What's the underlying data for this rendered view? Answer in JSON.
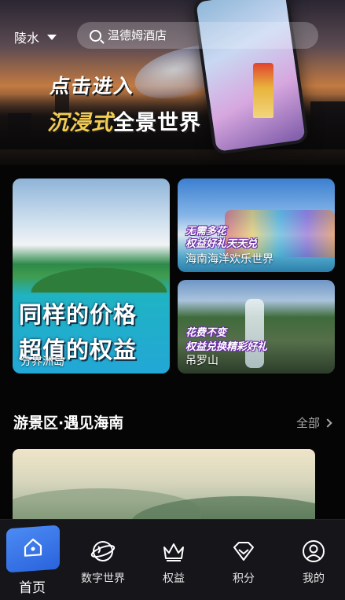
{
  "header": {
    "location": "陵水",
    "search_placeholder": "温德姆酒店"
  },
  "hero": {
    "title_line1": "点击进入",
    "title_line2_highlight": "沉浸式",
    "title_line2_rest": "全景世界"
  },
  "cards": {
    "big": {
      "slogan_line1": "同样的价格",
      "slogan_line2": "超值的权益",
      "name": "分界洲岛"
    },
    "small1": {
      "slogan_line1": "无需多花",
      "slogan_line2": "权益好礼天天兑",
      "name": "海南海洋欢乐世界"
    },
    "small2": {
      "slogan_line1": "花费不变",
      "slogan_line2": "权益兑换精彩好礼",
      "name": "吊罗山"
    }
  },
  "section": {
    "title": "游景区·遇见海南",
    "more_label": "全部"
  },
  "tabbar": {
    "items": [
      {
        "label": "首页",
        "icon": "home-icon",
        "active": true
      },
      {
        "label": "数字世界",
        "icon": "globe-icon",
        "active": false
      },
      {
        "label": "权益",
        "icon": "crown-icon",
        "active": false
      },
      {
        "label": "积分",
        "icon": "diamond-icon",
        "active": false
      },
      {
        "label": "我的",
        "icon": "user-icon",
        "active": false
      }
    ]
  },
  "colors": {
    "background": "#050505",
    "accent_blue": "#3a78ee",
    "hero_highlight": "#f3cc52",
    "muted_text": "#a8a8a8"
  }
}
